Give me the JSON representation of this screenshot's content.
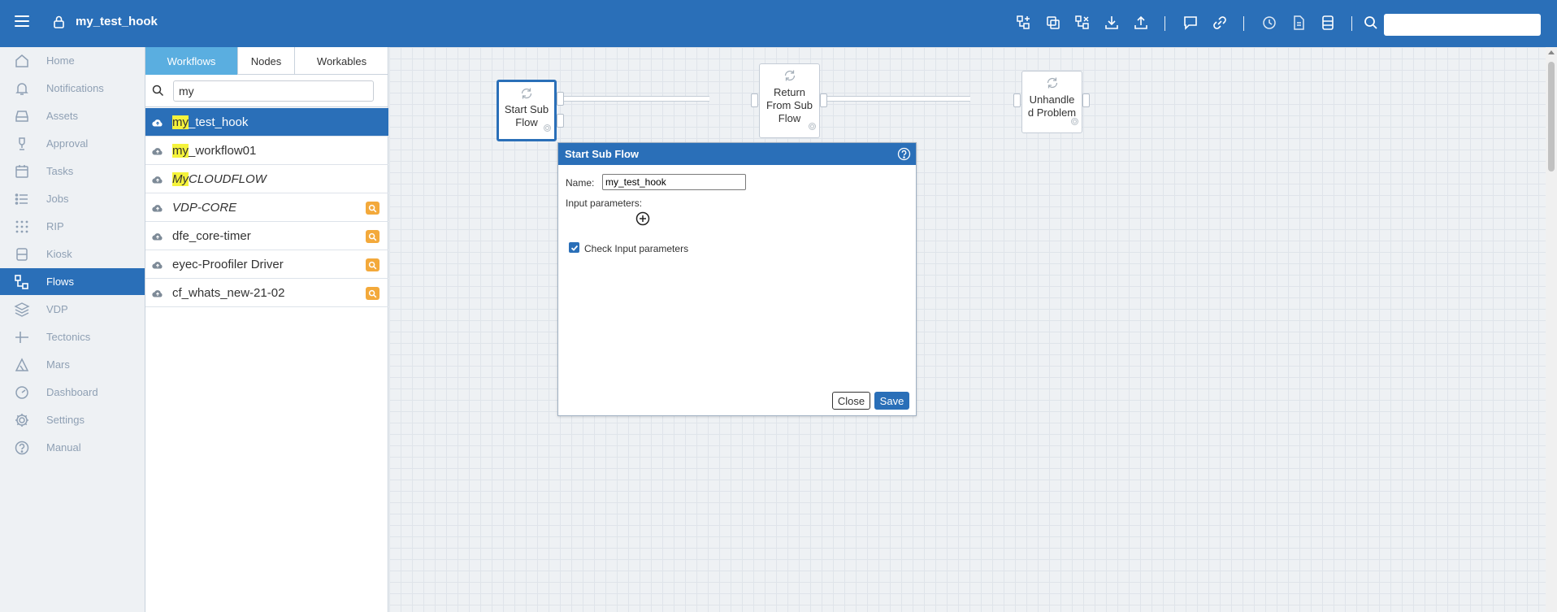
{
  "app": {
    "title": "my_test_hook",
    "search_placeholder": ""
  },
  "toolbar": {
    "icons": [
      "add-node-icon",
      "copy-icon",
      "layout-icon",
      "download-icon",
      "upload-icon",
      "comment-icon",
      "link-icon",
      "history-icon",
      "document-icon",
      "database-icon",
      "search-icon"
    ]
  },
  "nav": {
    "items": [
      {
        "label": "Home",
        "icon": "home-icon"
      },
      {
        "label": "Notifications",
        "icon": "bell-icon"
      },
      {
        "label": "Assets",
        "icon": "drive-icon"
      },
      {
        "label": "Approval",
        "icon": "approval-icon"
      },
      {
        "label": "Tasks",
        "icon": "calendar-icon"
      },
      {
        "label": "Jobs",
        "icon": "list-icon"
      },
      {
        "label": "RIP",
        "icon": "dots-icon"
      },
      {
        "label": "Kiosk",
        "icon": "kiosk-icon"
      },
      {
        "label": "Flows",
        "icon": "flows-icon",
        "active": true
      },
      {
        "label": "VDP",
        "icon": "layers-icon"
      },
      {
        "label": "Tectonics",
        "icon": "tectonics-icon"
      },
      {
        "label": "Mars",
        "icon": "mars-icon"
      },
      {
        "label": "Dashboard",
        "icon": "gauge-icon"
      },
      {
        "label": "Settings",
        "icon": "gear-icon"
      },
      {
        "label": "Manual",
        "icon": "help-icon"
      }
    ]
  },
  "panel": {
    "tabs": [
      "Workflows",
      "Nodes",
      "Workables"
    ],
    "search_value": "my",
    "workflows": [
      {
        "prefix": "my",
        "rest": "_test_hook",
        "selected": true
      },
      {
        "prefix": "my",
        "rest": "_workflow01"
      },
      {
        "prefix": "My",
        "rest": "CLOUDFLOW",
        "italic": true
      },
      {
        "prefix": "",
        "rest": "VDP-CORE",
        "italic": true,
        "badge": true
      },
      {
        "prefix": "",
        "rest": "dfe_core-timer",
        "badge": true
      },
      {
        "prefix": "",
        "rest": "eyec-Proofiler Driver",
        "badge": true
      },
      {
        "prefix": "",
        "rest": "cf_whats_new-21-02",
        "badge": true
      }
    ]
  },
  "canvas": {
    "nodes": [
      {
        "label_1": "Start Sub",
        "label_2": "Flow"
      },
      {
        "label_1": "Return",
        "label_2": "From Sub",
        "label_3": "Flow"
      },
      {
        "label_1": "Unhandle",
        "label_2": "d Problem"
      }
    ]
  },
  "dialog": {
    "title": "Start Sub Flow",
    "name_label": "Name:",
    "name_value": "my_test_hook",
    "input_params_label": "Input parameters:",
    "check_label": "Check Input parameters",
    "check_checked": true,
    "close_label": "Close",
    "save_label": "Save"
  },
  "colors": {
    "primary": "#2a6fb8",
    "highlight": "#f5f33b",
    "badge": "#f3a93b",
    "tab_active": "#5aaee0"
  }
}
